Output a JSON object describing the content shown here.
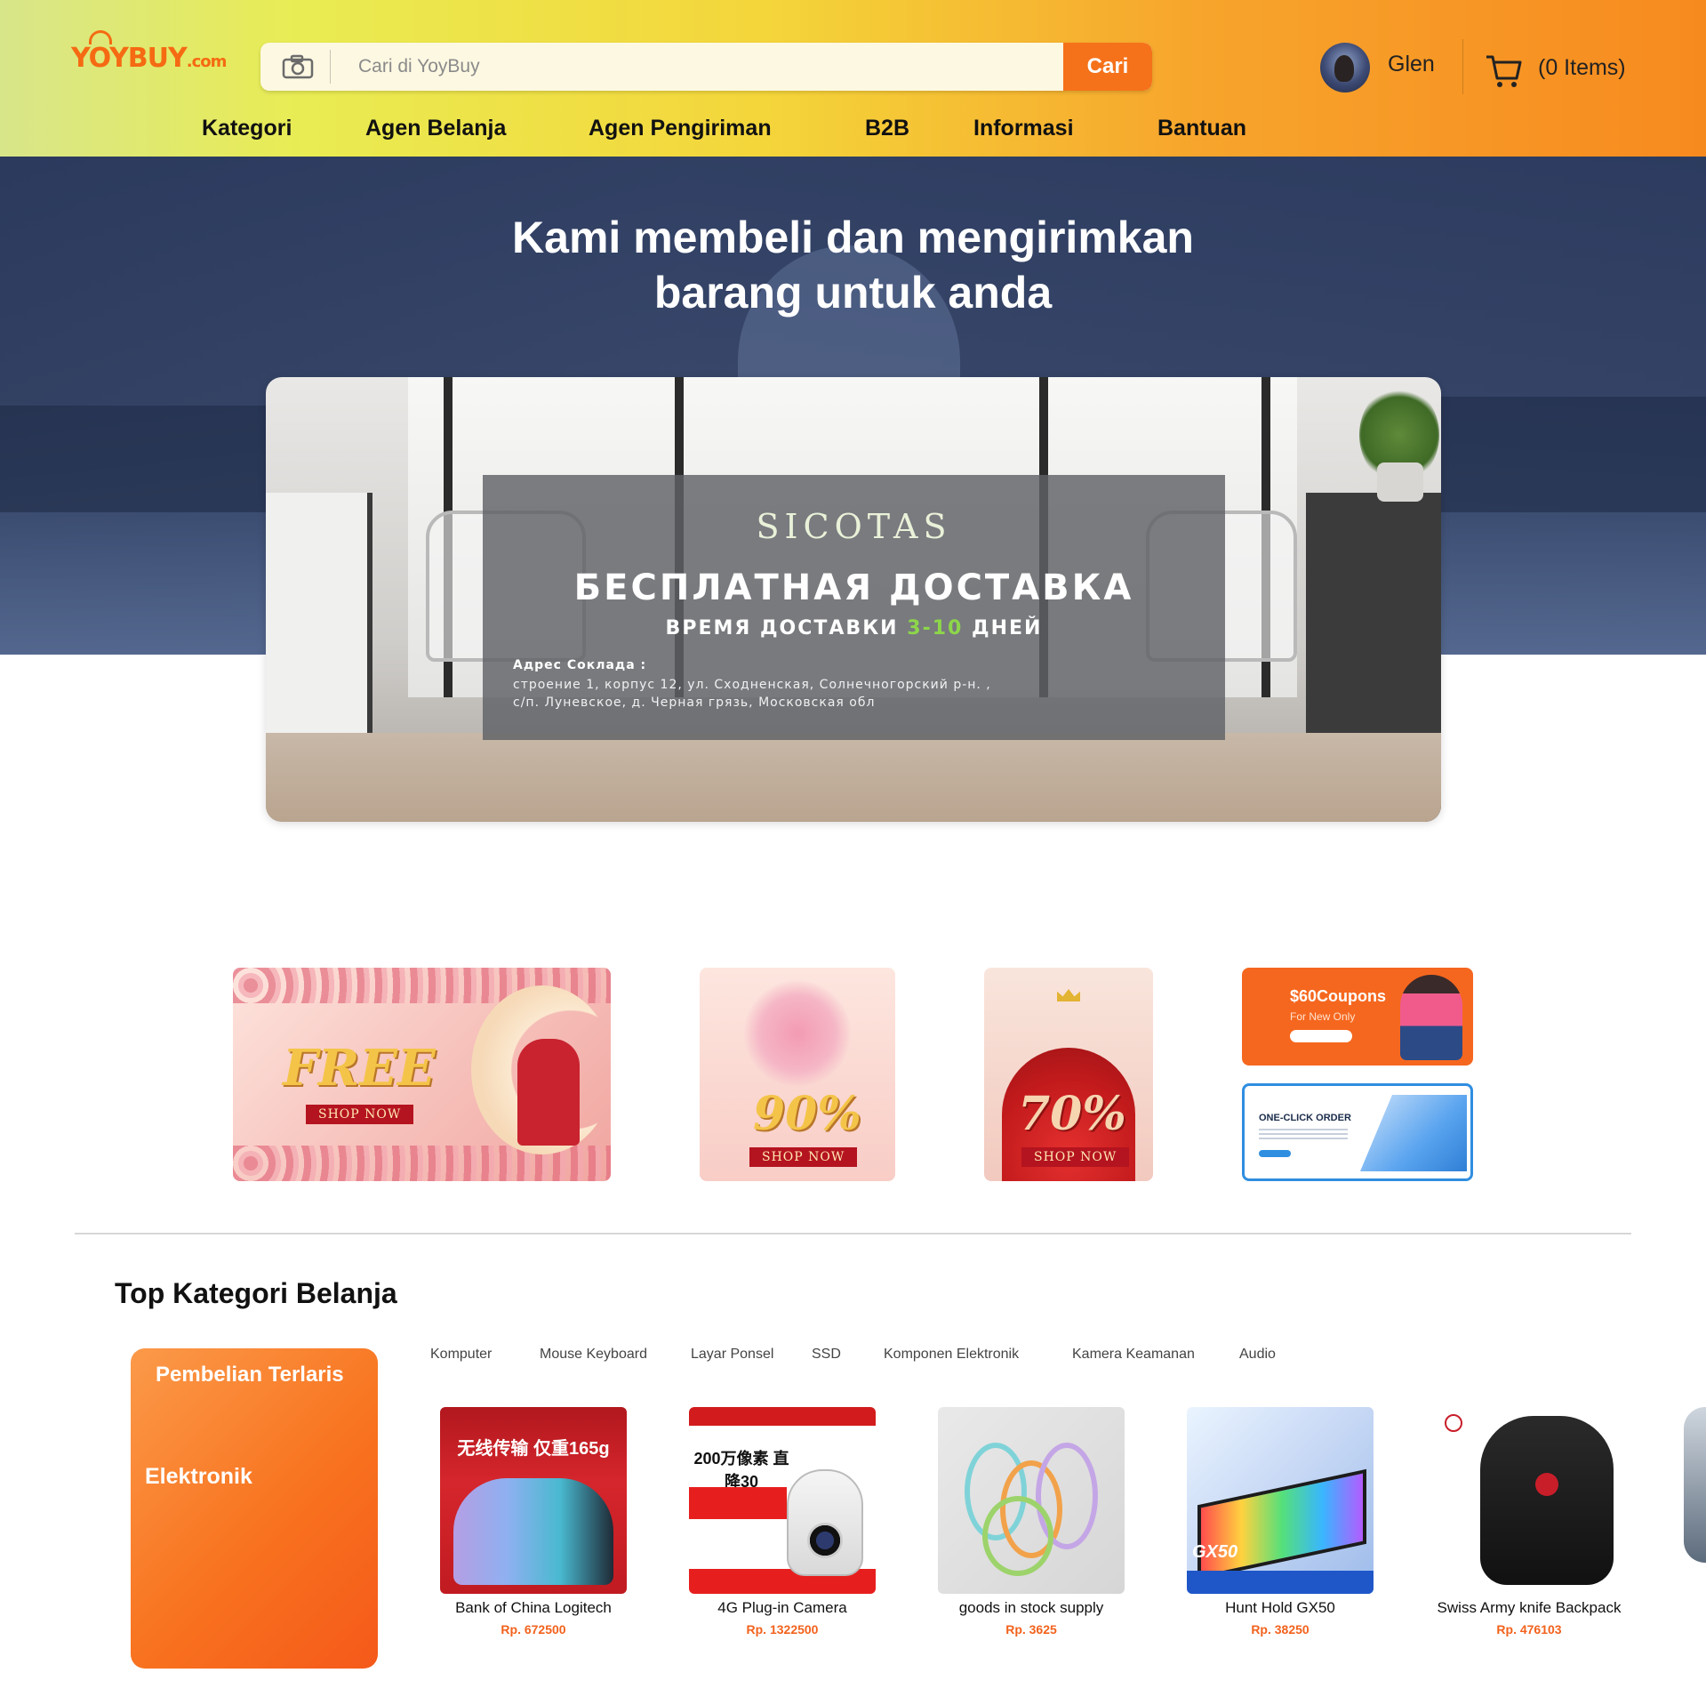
{
  "header": {
    "logo_main": "YOYBUY",
    "logo_suffix": ".com",
    "search_placeholder": "Cari di YoyBuy",
    "search_button": "Cari",
    "user_name": "Glen",
    "cart_label": "(0 Items)",
    "nav": [
      "Kategori",
      "Agen Belanja",
      "Agen Pengiriman",
      "B2B",
      "Informasi",
      "Bantuan"
    ]
  },
  "hero": {
    "title_line1": "Kami membeli dan mengirimkan",
    "title_line2": "barang untuk anda"
  },
  "banner": {
    "brand": "SICOTAS",
    "headline": "БЕСПЛАТНАЯ ДОСТАВКА",
    "sub_prefix": "ВРЕМЯ ДОСТАВКИ ",
    "sub_highlight": "3-10",
    "sub_suffix": " ДНЕЙ",
    "address_label": "Адрес Соклада :",
    "address_line1": "строение 1, корпус 12,  ул. Сходненская, Солнечногорский р-н. ,",
    "address_line2": "с/п. Луневское, д. Черная грязь, Московская обл"
  },
  "promos": {
    "free": {
      "big": "FREE",
      "shop": "SHOP NOW"
    },
    "p90": {
      "big": "90%",
      "shop": "SHOP NOW"
    },
    "p70": {
      "big": "70%",
      "shop": "SHOP NOW"
    },
    "coupon": {
      "title": "$60Coupons",
      "sub": "For New Only"
    },
    "order": {
      "title": "ONE-CLICK ORDER"
    }
  },
  "categories": {
    "title": "Top Kategori Belanja",
    "side_title": "Pembelian Terlaris",
    "side_sub": "Elektronik",
    "tabs": [
      "Komputer",
      "Mouse Keyboard",
      "Layar Ponsel",
      "SSD",
      "Komponen Elektronik",
      "Kamera Keamanan",
      "Audio"
    ],
    "products": [
      {
        "name": "Bank of China Logitech",
        "price": "Rp. 672500",
        "img_text": "无线传输 仅重165g"
      },
      {
        "name": "4G Plug-in Camera",
        "price": "Rp. 1322500",
        "img_text": "200万像素 直降30"
      },
      {
        "name": "goods in stock supply",
        "price": "Rp. 3625"
      },
      {
        "name": "Hunt Hold GX50",
        "price": "Rp. 38250",
        "img_text": "GX50"
      },
      {
        "name": "Swiss Army knife Backpack",
        "price": "Rp. 476103"
      }
    ]
  },
  "colors": {
    "accent": "#f5721a",
    "price": "#f2621d",
    "highlight_green": "#8dd64a"
  }
}
